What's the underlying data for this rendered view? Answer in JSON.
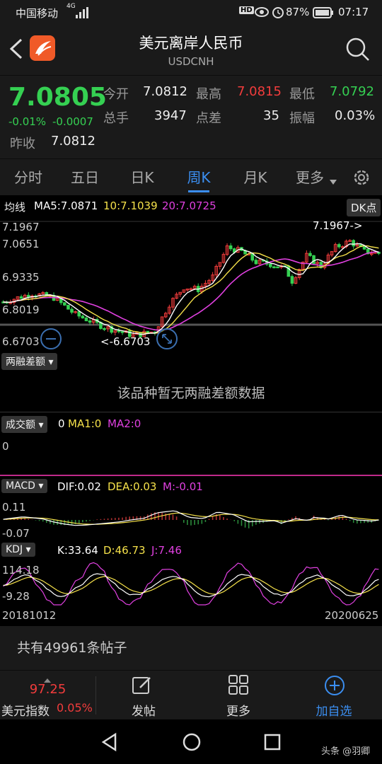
{
  "status": {
    "carrier": "中国移动",
    "network": "4G",
    "battery": "87%",
    "time": "07:17",
    "hd": "HD"
  },
  "header": {
    "title": "美元离岸人民币",
    "subtitle": "USDCNH"
  },
  "quote": {
    "price": "7.0805",
    "change": "-0.01%",
    "change_abs": "-0.0007",
    "prev_close_label": "昨收",
    "prev_close": "7.0812",
    "open_label": "今开",
    "open": "7.0812",
    "high_label": "最高",
    "high": "7.0815",
    "low_label": "最低",
    "low": "7.0792",
    "volume_label": "总手",
    "volume": "3947",
    "spread_label": "点差",
    "spread": "35",
    "amplitude_label": "振幅",
    "amplitude": "0.03%"
  },
  "tabs": [
    "分时",
    "五日",
    "日K",
    "周K",
    "月K",
    "更多"
  ],
  "active_tab": "周K",
  "ma": {
    "label": "均线",
    "ma5": "MA5:7.0871",
    "ma10": "10:7.1039",
    "ma20": "20:7.0725",
    "dk_button": "DK点"
  },
  "kline": {
    "ytick_1": "7.1967",
    "ytick_2": "7.0651",
    "ytick_3": "6.9335",
    "ytick_4": "6.8019",
    "ytick_5": "6.6703",
    "max_annotation": "7.1967->",
    "min_annotation": "<-6.6703"
  },
  "margin": {
    "label": "两融差额",
    "empty_text": "该品种暂无两融差额数据"
  },
  "turnover": {
    "label": "成交额",
    "value": "0",
    "ma1": "MA1:0",
    "ma2": "MA2:0",
    "axis_zero": "0"
  },
  "macd": {
    "label": "MACD",
    "dif": "DIF:0.02",
    "dea": "DEA:0.03",
    "m": "M:-0.01",
    "ytop": "0.11",
    "ybottom": "-0.07"
  },
  "kdj": {
    "label": "KDJ",
    "k": "K:33.64",
    "d": "D:46.73",
    "j": "J:7.46",
    "ytop": "114.18",
    "ybottom": "-9.28"
  },
  "dates": {
    "start": "20181012",
    "end": "20200625"
  },
  "posts": {
    "text": "共有49961条帖子"
  },
  "bottom": {
    "index_value": "97.25",
    "index_name": "美元指数",
    "index_change": "0.05%",
    "post_label": "发帖",
    "more_label": "更多",
    "add_label": "加自选"
  },
  "watermark": "头条 @羽卿",
  "colors": {
    "up": "#f23c3c",
    "down": "#35d052",
    "accent": "#3b8ef0",
    "ma5": "#ffffff",
    "ma10": "#f5e14a",
    "ma20": "#e040e0"
  },
  "chart_data": {
    "type": "candlestick",
    "x_range": [
      "20181012",
      "20200625"
    ],
    "ylim": [
      6.6703,
      7.1967
    ],
    "yticks": [
      7.1967,
      7.0651,
      6.9335,
      6.8019,
      6.6703
    ],
    "series": [
      {
        "name": "MA5",
        "value": 7.0871
      },
      {
        "name": "MA10",
        "value": 7.1039
      },
      {
        "name": "MA20",
        "value": 7.0725
      }
    ],
    "annotations": [
      {
        "text": "7.1967->",
        "value": 7.1967
      },
      {
        "text": "<-6.6703",
        "value": 6.6703
      }
    ]
  }
}
